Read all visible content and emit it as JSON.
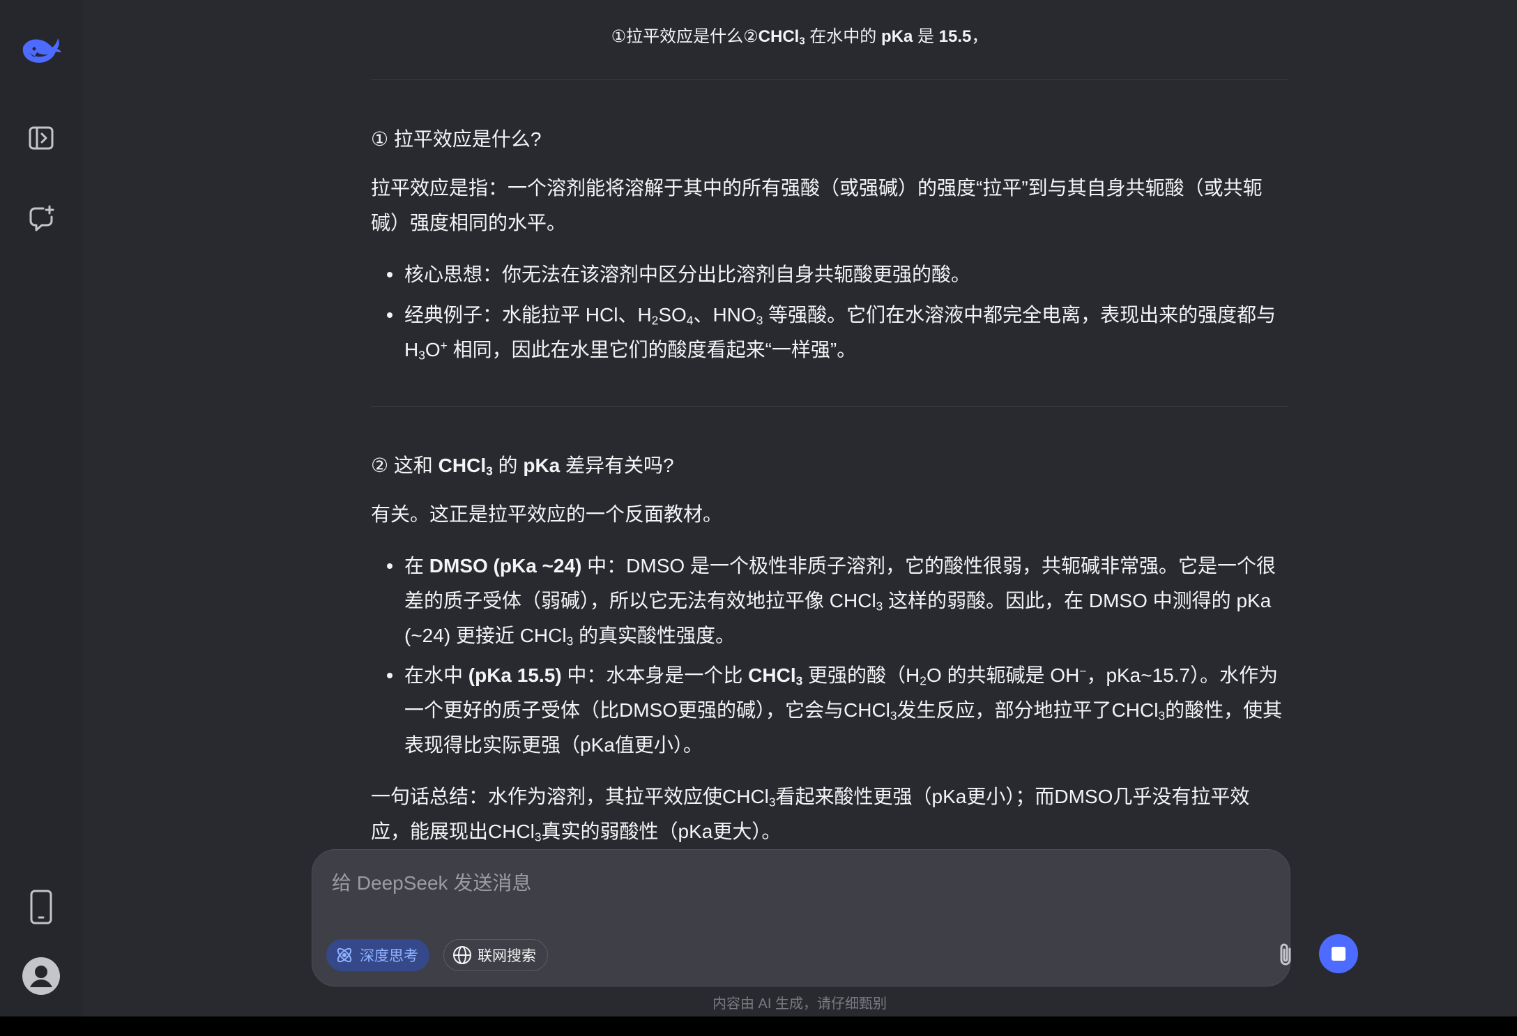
{
  "sidebar": {
    "logo": "deepseek-whale-logo",
    "toggle_icon": "sidebar-toggle-icon",
    "new_chat_icon": "new-chat-icon",
    "app_icon": "mobile-app-icon",
    "avatar_icon": "user-avatar-icon"
  },
  "question": {
    "p1": "①拉平效应是什么②",
    "p2_bold": "CHCl",
    "p2_sub": "3",
    "p3": " 在水中的 ",
    "p4_bold": "pKa",
    "p5": " 是 ",
    "p6_bold": "15.5",
    "p7": "，"
  },
  "section1": {
    "heading": "① 拉平效应是什么?",
    "definition": "拉平效应是指：一个溶剂能将溶解于其中的所有强酸（或强碱）的强度“拉平”到与其自身共轭酸（或共轭碱）强度相同的水平。",
    "bullet1": "核心思想：你无法在该溶剂中区分出比溶剂自身共轭酸更强的酸。",
    "bullet2": {
      "a": "经典例子：水能拉平 HCl、H",
      "sub1": "2",
      "b": "SO",
      "sub2": "4",
      "c": "、HNO",
      "sub3": "3",
      "d": " 等强酸。它们在水溶液中都完全电离，表现出来的强度都与 H",
      "sub4": "3",
      "e": "O",
      "sup1": "+",
      "f": " 相同，因此在水里它们的酸度看起来“一样强”。"
    }
  },
  "section2": {
    "heading": {
      "a": "② 这和 ",
      "b_bold": "CHCl",
      "b_sub": "3",
      "c": " 的 ",
      "d_bold": "pKa",
      "e": " 差异有关吗?"
    },
    "intro": "有关。这正是拉平效应的一个反面教材。",
    "bullet1": {
      "a": "在 ",
      "b_bold": "DMSO (pKa ~24)",
      "c": " 中：DMSO 是一个极性非质子溶剂，它的酸性很弱，共轭碱非常强。它是一个很差的质子受体（弱碱），所以它无法有效地拉平像 CHCl",
      "sub1": "3",
      "d": " 这样的弱酸。因此，在 DMSO 中测得的 pKa (~24) 更接近 CHCl",
      "sub2": "3",
      "e": " 的真实酸性强度。"
    },
    "bullet2": {
      "a": "在水中 ",
      "b_bold": "(pKa 15.5)",
      "c": " 中：水本身是一个比 ",
      "d_bold": "CHCl",
      "d_sub": "3",
      "e": " 更强的酸（H",
      "sub1": "2",
      "f": "O 的共轭碱是 OH",
      "sup1": "−",
      "g": "，pKa~15.7）。水作为一个更好的质子受体（比DMSO更强的碱），它会与CHCl",
      "sub2": "3",
      "h": "发生反应，部分地拉平了CHCl",
      "sub3": "3",
      "i": "的酸性，使其表现得比实际更强（pKa值更小）。"
    },
    "summary": {
      "a": "一句话总结：水作为溶剂，其拉平效应使CHCl",
      "sub1": "3",
      "b": "看起来酸性更强（pKa更小）；而DMSO几乎没有拉平效应，能展现出CHCl",
      "sub2": "3",
      "c": "真实的弱酸性（pKa更大）。"
    }
  },
  "composer": {
    "placeholder": "给 DeepSeek 发送消息",
    "deep_think_label": "深度思考",
    "web_search_label": "联网搜索",
    "attach_icon": "paperclip-icon",
    "stop_icon": "stop-icon"
  },
  "disclaimer": "内容由 AI 生成，请仔细甄别",
  "colors": {
    "accent": "#4d6bfe",
    "chip_bg": "#34488a",
    "chip_text": "#8fb2ff",
    "main_bg": "#292a2f",
    "sidebar_bg": "#26272c"
  }
}
